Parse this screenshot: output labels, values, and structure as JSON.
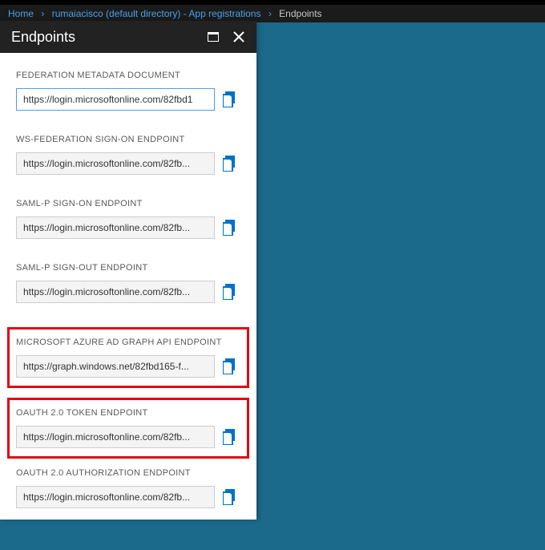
{
  "breadcrumb": {
    "home": "Home",
    "dir": "rumaiacisco (default directory) - App registrations",
    "leaf": "Endpoints"
  },
  "blade": {
    "title": "Endpoints"
  },
  "endpoints": {
    "fed_meta": {
      "label": "FEDERATION METADATA DOCUMENT",
      "value": "https://login.microsoftonline.com/82fbd1"
    },
    "ws_fed": {
      "label": "WS-FEDERATION SIGN-ON ENDPOINT",
      "value": "https://login.microsoftonline.com/82fb..."
    },
    "saml_signon": {
      "label": "SAML-P SIGN-ON ENDPOINT",
      "value": "https://login.microsoftonline.com/82fb..."
    },
    "saml_signout": {
      "label": "SAML-P SIGN-OUT ENDPOINT",
      "value": "https://login.microsoftonline.com/82fb..."
    },
    "graph": {
      "label": "MICROSOFT AZURE AD GRAPH API ENDPOINT",
      "value": "https://graph.windows.net/82fbd165-f..."
    },
    "oauth_token": {
      "label": "OAUTH 2.0 TOKEN ENDPOINT",
      "value": "https://login.microsoftonline.com/82fb..."
    },
    "oauth_auth": {
      "label": "OAUTH 2.0 AUTHORIZATION ENDPOINT",
      "value": "https://login.microsoftonline.com/82fb..."
    }
  }
}
